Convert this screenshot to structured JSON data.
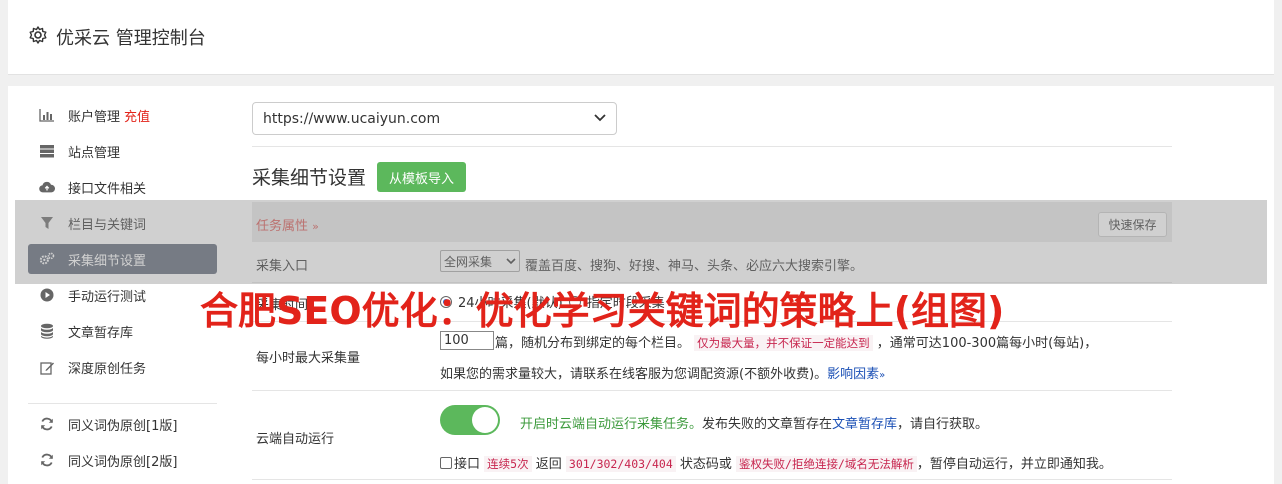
{
  "header": {
    "title": "优采云 管理控制台",
    "icon": "gear-icon"
  },
  "sidebar": {
    "items": [
      {
        "label": "账户管理",
        "badge": "充值",
        "icon": "bar-chart-icon"
      },
      {
        "label": "站点管理",
        "icon": "server-icon"
      },
      {
        "label": "接口文件相关",
        "icon": "cloud-upload-icon"
      },
      {
        "label": "栏目与关键词",
        "icon": "filter-icon"
      },
      {
        "label": "采集细节设置",
        "icon": "gears-icon",
        "active": true
      },
      {
        "label": "手动运行测试",
        "icon": "play-circle-icon"
      },
      {
        "label": "文章暂存库",
        "icon": "database-icon"
      },
      {
        "label": "深度原创任务",
        "icon": "edit-icon"
      },
      {
        "label": "同义词伪原创[1版]",
        "icon": "refresh-icon"
      },
      {
        "label": "同义词伪原创[2版]",
        "icon": "refresh-icon"
      }
    ]
  },
  "site_select": {
    "value": "https://www.ucaiyun.com"
  },
  "section": {
    "title": "采集细节设置",
    "import_button": "从模板导入"
  },
  "task_bar": {
    "label": "任务属性",
    "save_button": "快速保存"
  },
  "collect_entry": {
    "label": "采集入口",
    "select_value": "全网采集",
    "help": "覆盖百度、搜狗、好搜、神马、头条、必应六大搜索引擎。"
  },
  "collect_time": {
    "label": "采集时间",
    "option_1": "24小时采集(默认)",
    "option_2": "指定时段采集"
  },
  "max_per_hour": {
    "label": "每小时最大采集量",
    "value": "100",
    "text_1": "篇，随机分布到绑定的每个栏目。",
    "highlight": "仅为最大量，并不保证一定能达到",
    "text_2": "，通常可达100-300篇每小时(每站)，",
    "text_3": "如果您的需求量较大，请联系在线客服为您调配资源(不额外收费)。",
    "link": "影响因素"
  },
  "cloud_auto": {
    "label": "云端自动运行",
    "toggle_on": true,
    "green_text": "开启时云端自动运行采集任务。",
    "text_1": "发布失败的文章暂存在",
    "link": "文章暂存库",
    "text_2": "，请自行获取。",
    "chk_text_1": "接口",
    "hl_1": "连续5次",
    "chk_text_2": "返回",
    "hl_2": "301/302/403/404",
    "chk_text_3": "状态码或",
    "hl_3": "鉴权失败/拒绝连接/域名无法解析",
    "chk_text_4": "，暂停自动运行，并立即通知我。"
  },
  "watermark": "合肥SEO优化：优化学习关键词的策略上(组图)",
  "colors": {
    "accent_green": "#5cb85c",
    "active_nav": "#5b6475",
    "warn_red": "#e2231a"
  }
}
